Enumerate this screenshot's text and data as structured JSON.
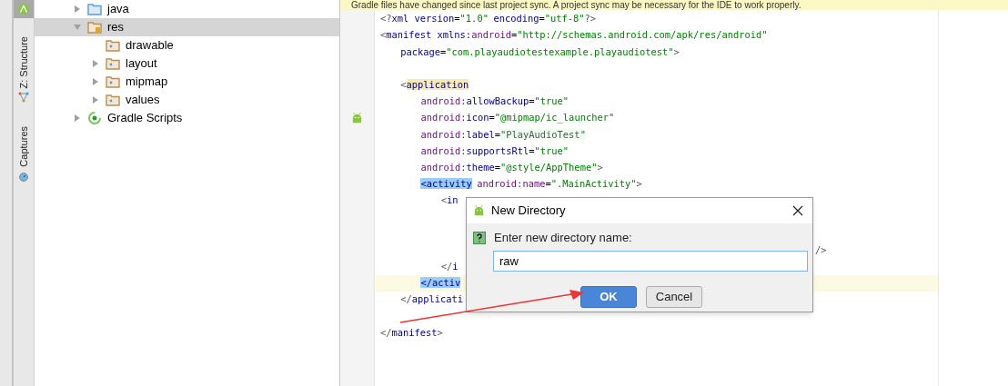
{
  "tool_strip": {
    "tabs": [
      {
        "label": "Z: Structure",
        "kind": "structure"
      },
      {
        "label": "Captures",
        "kind": "captures"
      }
    ]
  },
  "project_tree": {
    "items": [
      {
        "label": "java",
        "kind": "source-folder",
        "expanded": false,
        "selected": false
      },
      {
        "label": "res",
        "kind": "resource-folder",
        "expanded": true,
        "selected": true,
        "children": [
          {
            "label": "drawable",
            "kind": "folder",
            "selected": false
          },
          {
            "label": "layout",
            "kind": "folder",
            "expanded": false,
            "selected": false
          },
          {
            "label": "mipmap",
            "kind": "folder",
            "expanded": false,
            "selected": false
          },
          {
            "label": "values",
            "kind": "folder",
            "expanded": false,
            "selected": false
          }
        ]
      },
      {
        "label": "Gradle Scripts",
        "kind": "gradle",
        "expanded": false,
        "selected": false
      }
    ]
  },
  "banner": {
    "text": "Gradle files have changed since last project sync. A project sync may be necessary for the IDE to work properly."
  },
  "editor": {
    "lines": [
      {
        "tokens": [
          {
            "t": "<?",
            "kind": "punct"
          },
          {
            "t": "xml version",
            "kind": "tag"
          },
          {
            "t": "=",
            "kind": "plain"
          },
          {
            "t": "\"1.0\"",
            "kind": "value"
          },
          {
            "t": " encoding",
            "kind": "tag"
          },
          {
            "t": "=",
            "kind": "plain"
          },
          {
            "t": "\"utf-8\"",
            "kind": "value"
          },
          {
            "t": "?>",
            "kind": "punct"
          }
        ]
      },
      {
        "tokens": [
          {
            "t": "<",
            "kind": "punct"
          },
          {
            "t": "manifest ",
            "kind": "tag"
          },
          {
            "t": "xmlns:",
            "kind": "tag"
          },
          {
            "t": "android",
            "kind": "attr"
          },
          {
            "t": "=",
            "kind": "plain"
          },
          {
            "t": "\"http://schemas.android.com/apk/res/android\"",
            "kind": "value"
          }
        ]
      },
      {
        "tokens": [
          {
            "t": "    package",
            "kind": "tag"
          },
          {
            "t": "=",
            "kind": "plain"
          },
          {
            "t": "\"com.playaudiotestexample.playaudiotest\"",
            "kind": "value"
          },
          {
            "t": ">",
            "kind": "punct"
          }
        ]
      },
      {
        "kind": "blank"
      },
      {
        "tokens": [
          {
            "t": "    <",
            "kind": "punct"
          },
          {
            "t": "application",
            "kind": "tag-caret"
          }
        ]
      },
      {
        "tokens": [
          {
            "t": "        android:",
            "kind": "attr"
          },
          {
            "t": "allowBackup",
            "kind": "tag"
          },
          {
            "t": "=",
            "kind": "plain"
          },
          {
            "t": "\"true\"",
            "kind": "value"
          }
        ]
      },
      {
        "kind": "android-marker",
        "tokens": [
          {
            "t": "        android:",
            "kind": "attr"
          },
          {
            "t": "icon",
            "kind": "tag"
          },
          {
            "t": "=",
            "kind": "plain"
          },
          {
            "t": "\"@mipmap/ic_launcher\"",
            "kind": "value"
          }
        ]
      },
      {
        "tokens": [
          {
            "t": "        android:",
            "kind": "attr"
          },
          {
            "t": "label",
            "kind": "tag"
          },
          {
            "t": "=",
            "kind": "plain"
          },
          {
            "t": "\"PlayAudioTest\"",
            "kind": "value-folded"
          }
        ]
      },
      {
        "tokens": [
          {
            "t": "        android:",
            "kind": "attr"
          },
          {
            "t": "supportsRtl",
            "kind": "tag"
          },
          {
            "t": "=",
            "kind": "plain"
          },
          {
            "t": "\"true\"",
            "kind": "value"
          }
        ]
      },
      {
        "tokens": [
          {
            "t": "        android:",
            "kind": "attr"
          },
          {
            "t": "theme",
            "kind": "tag"
          },
          {
            "t": "=",
            "kind": "plain"
          },
          {
            "t": "\"@style/AppTheme\"",
            "kind": "value"
          },
          {
            "t": ">",
            "kind": "punct"
          }
        ]
      },
      {
        "tokens": [
          {
            "t": "        <activity",
            "kind": "tag-match"
          },
          {
            "t": " android:",
            "kind": "attr"
          },
          {
            "t": "name",
            "kind": "attr"
          },
          {
            "t": "=",
            "kind": "plain"
          },
          {
            "t": "\".MainActivity\"",
            "kind": "value"
          },
          {
            "t": ">",
            "kind": "punct"
          }
        ]
      },
      {
        "tokens": [
          {
            "t": "            <",
            "kind": "punct"
          },
          {
            "t": "in",
            "kind": "tag"
          }
        ]
      },
      {
        "kind": "blank"
      },
      {
        "kind": "blank"
      },
      {
        "kind": "tail",
        "tail": "/>"
      },
      {
        "tokens": [
          {
            "t": "            </",
            "kind": "punct"
          },
          {
            "t": "i",
            "kind": "tag"
          }
        ]
      },
      {
        "current": true,
        "tokens": [
          {
            "t": "        </activ",
            "kind": "tag-match"
          }
        ]
      },
      {
        "tokens": [
          {
            "t": "    </",
            "kind": "punct"
          },
          {
            "t": "applicati",
            "kind": "tag"
          }
        ]
      },
      {
        "kind": "blank"
      },
      {
        "tokens": [
          {
            "t": "</",
            "kind": "punct"
          },
          {
            "t": "manifest",
            "kind": "tag"
          },
          {
            "t": ">",
            "kind": "punct"
          }
        ]
      }
    ]
  },
  "dialog": {
    "title": "New Directory",
    "prompt": "Enter new directory name:",
    "value": "raw",
    "buttons": [
      {
        "label": "OK",
        "kind": "primary"
      },
      {
        "label": "Cancel",
        "kind": "secondary"
      }
    ]
  }
}
